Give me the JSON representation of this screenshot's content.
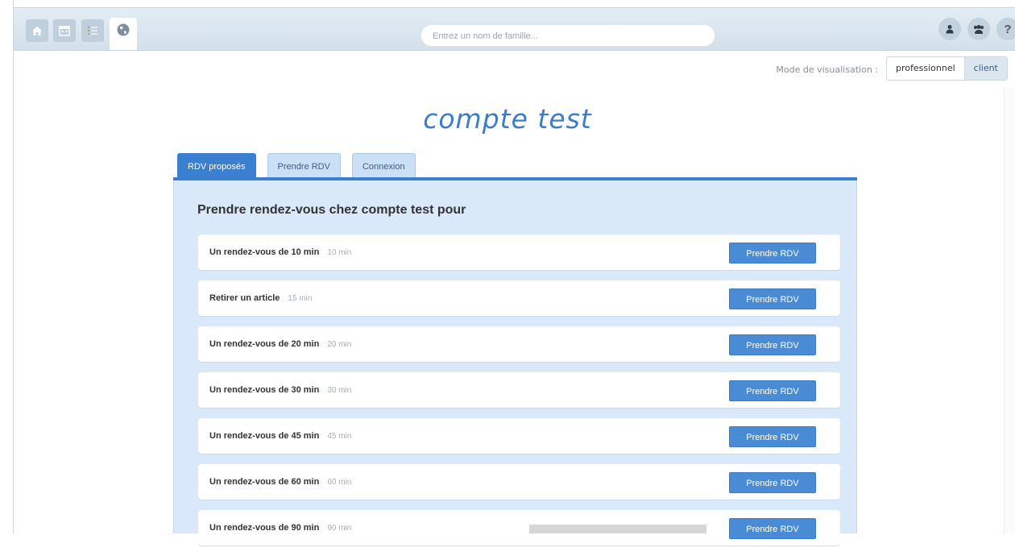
{
  "topbar": {
    "nav": [
      {
        "icon": "home-icon",
        "active": false
      },
      {
        "icon": "calendar-icon",
        "active": false
      },
      {
        "icon": "list-icon",
        "active": false
      },
      {
        "icon": "globe-icon",
        "active": true
      }
    ],
    "search_placeholder": "Entrez un nom de famille...",
    "right_icons": [
      "user-icon",
      "group-icon",
      "help-icon"
    ],
    "help_glyph": "?"
  },
  "view_mode": {
    "label": "Mode de visualisation :",
    "options": [
      "professionnel",
      "client"
    ],
    "selected": "client"
  },
  "title": "compte test",
  "tabs": [
    {
      "label": "RDV proposés",
      "active": true
    },
    {
      "label": "Prendre RDV",
      "active": false
    },
    {
      "label": "Connexion",
      "active": false
    }
  ],
  "panel": {
    "heading": "Prendre rendez-vous chez compte test pour",
    "rows": [
      {
        "name": "Un rendez-vous de 10 min",
        "duration": "10 min",
        "button": "Prendre RDV"
      },
      {
        "name": "Retirer un article",
        "duration": "15 min",
        "button": "Prendre RDV"
      },
      {
        "name": "Un rendez-vous de 20 min",
        "duration": "20 min",
        "button": "Prendre RDV"
      },
      {
        "name": "Un rendez-vous de 30 min",
        "duration": "30 min",
        "button": "Prendre RDV"
      },
      {
        "name": "Un rendez-vous de 45 min",
        "duration": "45 min",
        "button": "Prendre RDV"
      },
      {
        "name": "Un rendez-vous de 60 min",
        "duration": "60 min",
        "button": "Prendre RDV"
      },
      {
        "name": "Un rendez-vous de 90 min",
        "duration": "90 min",
        "button": "Prendre RDV"
      }
    ]
  },
  "colors": {
    "accent": "#3a7fd0",
    "title": "#3d7cc9",
    "panel_bg": "#d9e9fa",
    "button": "#4a8bd6"
  }
}
